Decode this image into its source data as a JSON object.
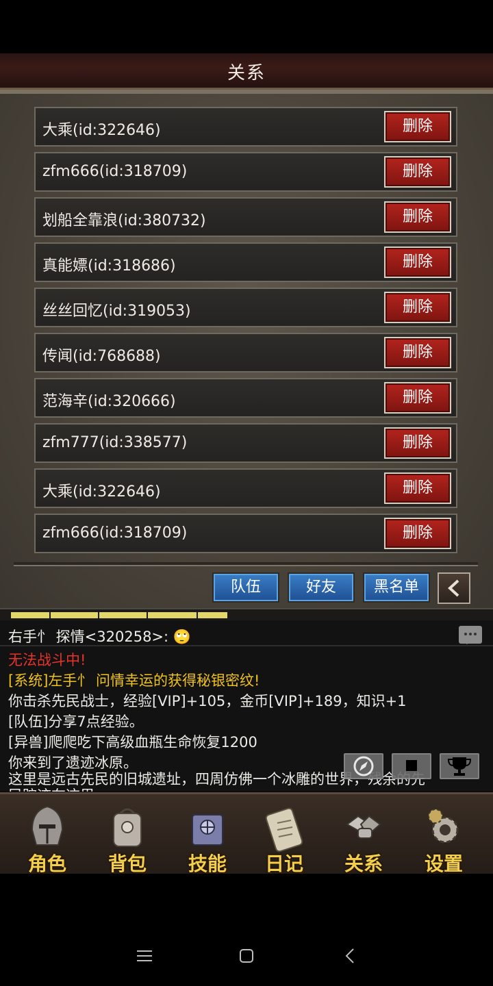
{
  "title": "关系",
  "friends": [
    {
      "name": "大乘(id:322646)",
      "action": "删除"
    },
    {
      "name": "zfm666(id:318709)",
      "action": "删除"
    },
    {
      "name": "划船全靠浪(id:380732)",
      "action": "删除"
    },
    {
      "name": "真能嫖(id:318686)",
      "action": "删除"
    },
    {
      "name": "丝丝回忆(id:319053)",
      "action": "删除"
    },
    {
      "name": "传闻(id:768688)",
      "action": "删除"
    },
    {
      "name": "范海辛(id:320666)",
      "action": "删除"
    },
    {
      "name": "zfm777(id:338577)",
      "action": "删除"
    },
    {
      "name": "大乘(id:322646)",
      "action": "删除"
    },
    {
      "name": "zfm666(id:318709)",
      "action": "删除"
    }
  ],
  "tabs": [
    "队伍",
    "好友",
    "黑名单"
  ],
  "chat": {
    "header": "右手忄 探情<320258>: 🙄",
    "lines": [
      {
        "text": "无法战斗中!",
        "color": "#e8332b"
      },
      {
        "text": "[系统]左手忄 问情幸运的获得秘银密纹!",
        "color": "#f0c21c"
      },
      {
        "text": "你击杀先民战士，经验[VIP]+105，金币[VIP]+189，知识+1",
        "color": "#ecebe7"
      },
      {
        "text": "[队伍]分享7点经验。",
        "color": "#ecebe7"
      },
      {
        "text": "[异兽]爬爬吃下高级血瓶生命恢复1200",
        "color": "#ecebe7"
      },
      {
        "text": "你来到了遗迹冰原。",
        "color": "#ecebe7"
      },
      {
        "text": "这里是远古先民的旧城遗址，四周仿佛一个冰雕的世界，残余的先",
        "color": "#ecebe7"
      },
      {
        "text": "民踪迹在这里",
        "color": "#ecebe7"
      }
    ]
  },
  "nav": [
    "角色",
    "背包",
    "技能",
    "日记",
    "关系",
    "设置"
  ],
  "colors": {
    "delete": "#b3241d",
    "tab": "#2f6db5",
    "nav_label": "#f4cf4b"
  }
}
